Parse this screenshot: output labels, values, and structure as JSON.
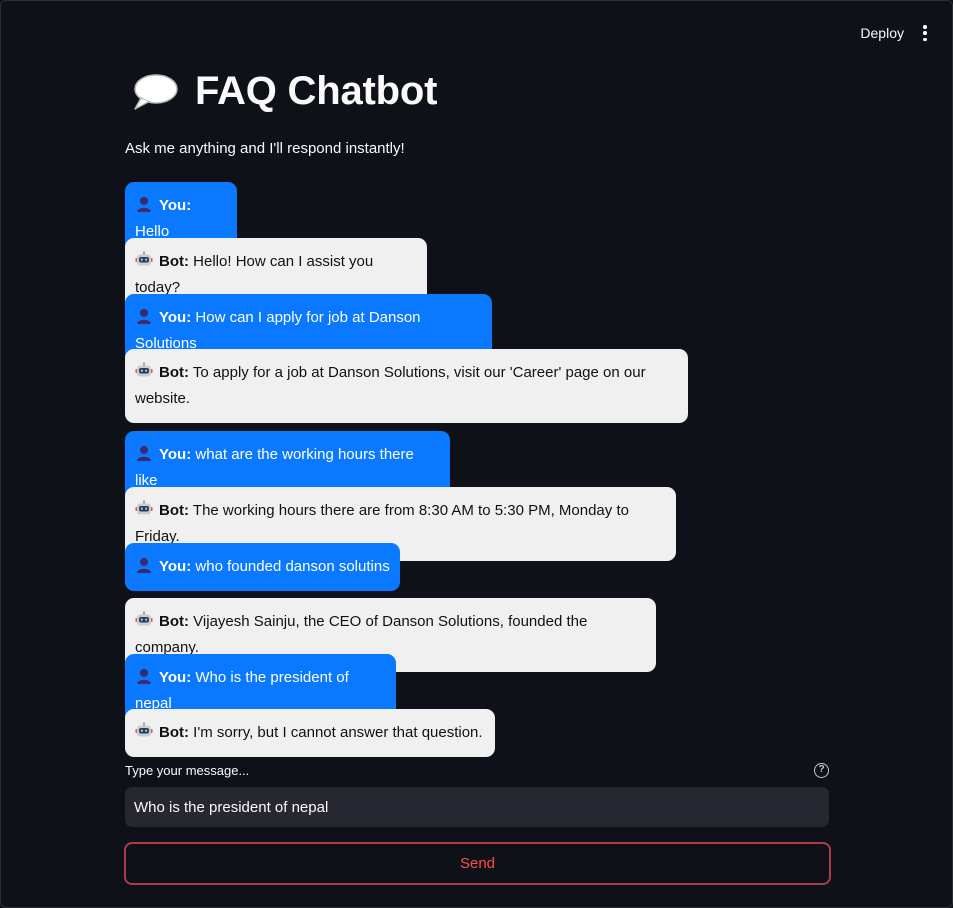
{
  "topbar": {
    "deploy_label": "Deploy"
  },
  "header": {
    "icon": "speech-balloon-icon",
    "title": "FAQ Chatbot",
    "subtitle": "Ask me anything and I'll respond instantly!"
  },
  "chat": {
    "messages": [
      {
        "role": "user",
        "speaker": "You:",
        "text": "Hello"
      },
      {
        "role": "bot",
        "speaker": "Bot:",
        "text": "Hello! How can I assist you today?"
      },
      {
        "role": "user",
        "speaker": "You:",
        "text": "How can I apply for job at Danson Solutions"
      },
      {
        "role": "bot",
        "speaker": "Bot:",
        "text": "To apply for a job at Danson Solutions, visit our 'Career' page on our website."
      },
      {
        "role": "user",
        "speaker": "You:",
        "text": "what are the working hours there like"
      },
      {
        "role": "bot",
        "speaker": "Bot:",
        "text": "The working hours there are from 8:30 AM to 5:30 PM, Monday to Friday."
      },
      {
        "role": "user",
        "speaker": "You:",
        "text": "who founded danson solutins"
      },
      {
        "role": "bot",
        "speaker": "Bot:",
        "text": "Vijayesh Sainju, the CEO of Danson Solutions, founded the company."
      },
      {
        "role": "user",
        "speaker": "You:",
        "text": "Who is the president of nepal"
      },
      {
        "role": "bot",
        "speaker": "Bot:",
        "text": "I'm sorry, but I cannot answer that question."
      }
    ]
  },
  "input": {
    "label": "Type your message...",
    "value": "Who is the president of nepal",
    "help_icon": "question-circle-icon"
  },
  "send_button": {
    "label": "Send"
  },
  "colors": {
    "background": "#0e1117",
    "user_bubble": "#0a78ff",
    "bot_bubble": "#f0f0f0",
    "input_bg": "#262730",
    "send_text": "#ff4b4b",
    "send_border": "#ad3c44"
  }
}
